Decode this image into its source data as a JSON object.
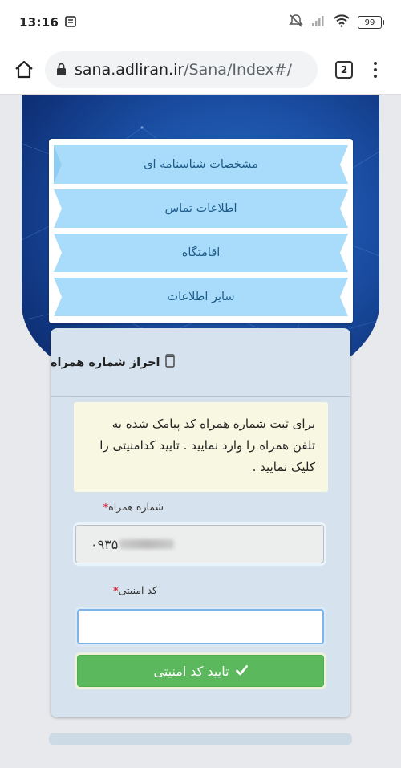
{
  "status_bar": {
    "time": "13:16",
    "battery": "99"
  },
  "browser": {
    "url_host": "sana.adliran.ir",
    "url_path": "/Sana/Index#/",
    "tab_count": "2"
  },
  "accordion": {
    "items": [
      {
        "label": "مشخصات شناسنامه ای"
      },
      {
        "label": "اطلاعات تماس"
      },
      {
        "label": "اقامتگاه"
      },
      {
        "label": "سایر اطلاعات"
      }
    ]
  },
  "verify_card": {
    "title": "احراز شماره همراه",
    "notice": "برای ثبت شماره همراه کد پیامک شده به تلفن همراه را وارد نمایید . تایید کدامنیتی را کلیک نمایید .",
    "phone_label": "شماره همراه",
    "phone_value": "۰۹۳۵",
    "code_label": "کد امنیتی",
    "code_value": "",
    "required_mark": "*",
    "submit_label": "تایید کد امنیتی"
  },
  "colors": {
    "accordion_item": "#a8dcfa",
    "accordion_text": "#1e5b8a",
    "card_bg": "#d6e3ee",
    "notice_bg": "#f8f8e2",
    "submit_bg": "#5cb85c",
    "required": "#d9263b"
  }
}
